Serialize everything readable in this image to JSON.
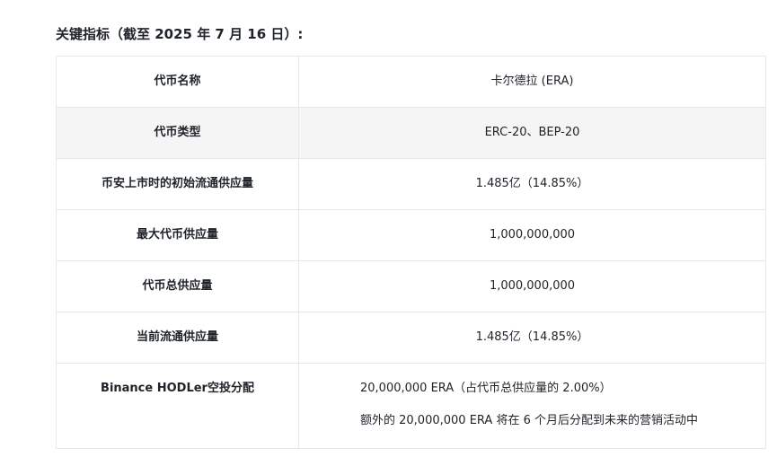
{
  "heading": "关键指标（截至 2025 年 7 月 16 日）:",
  "rows": [
    {
      "label": "代币名称",
      "value": "卡尔德拉 (ERA)"
    },
    {
      "label": "代币类型",
      "value": "ERC-20、BEP-20"
    },
    {
      "label": "币安上市时的初始流通供应量",
      "value": "1.485亿（14.85%）"
    },
    {
      "label": "最大代币供应量",
      "value": "1,000,000,000"
    },
    {
      "label": "代币总供应量",
      "value": "1,000,000,000"
    },
    {
      "label": "当前流通供应量",
      "value": "1.485亿（14.85%）"
    },
    {
      "label": "Binance HODLer空投分配",
      "lines": [
        "20,000,000 ERA（占代币总供应量的 2.00%）",
        "额外的 20,000,000 ERA 将在 6 个月后分配到未来的营销活动中"
      ]
    }
  ]
}
